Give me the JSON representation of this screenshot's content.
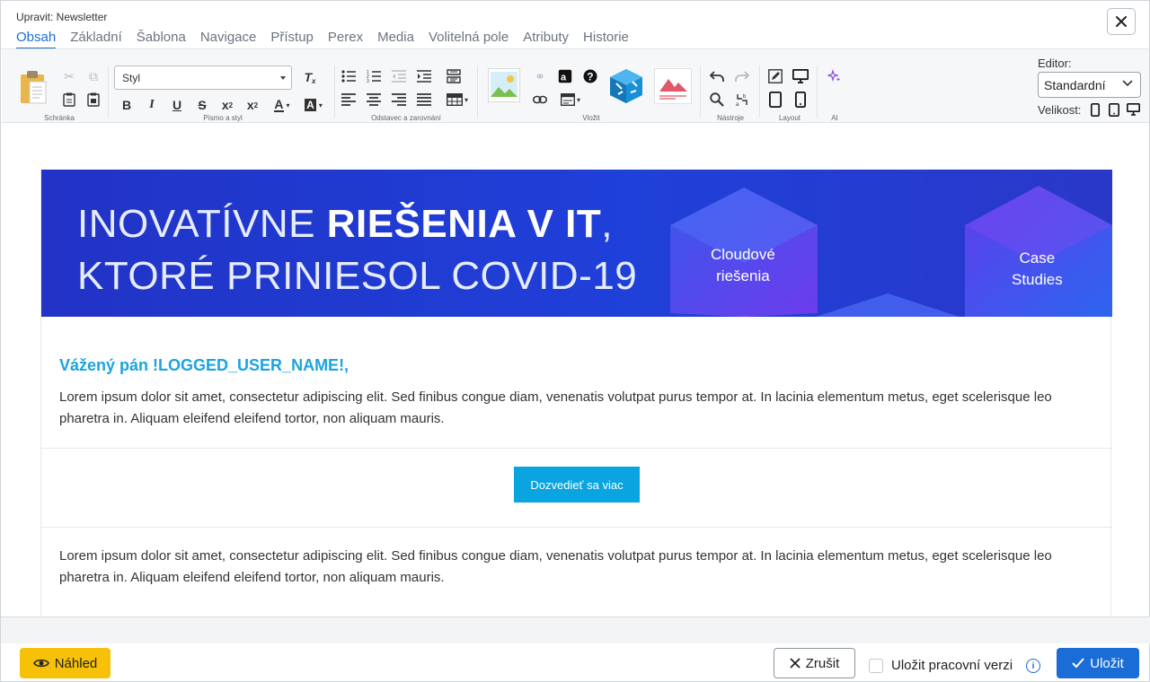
{
  "header": {
    "title": "Upravit: Newsletter",
    "tabs": [
      "Obsah",
      "Základní",
      "Šablona",
      "Navigace",
      "Přístup",
      "Perex",
      "Media",
      "Volitelná pole",
      "Atributy",
      "Historie"
    ],
    "active_tab": "Obsah"
  },
  "toolbar": {
    "style_select": "Styl",
    "groups": {
      "clipboard": "Schránka",
      "font": "Písmo a styl",
      "paragraph": "Odstavec a zarovnání",
      "insert": "Vložit",
      "tools": "Nástroje",
      "layout": "Layout",
      "ai": "AI"
    },
    "editor_label": "Editor:",
    "editor_value": "Standardní",
    "size_label": "Velikost:"
  },
  "newsletter": {
    "banner": {
      "line1_light": "INOVATÍVNE ",
      "line1_bold": "RIEŠENIA V IT",
      "line1_comma": ",",
      "line2": "KTORÉ PRINIESOL COVID-19",
      "cube1_line1": "Cloudové",
      "cube1_line2": "riešenia",
      "cube2_line1": "Case",
      "cube2_line2": "Studies"
    },
    "greeting": "Vážený pán !LOGGED_USER_NAME!,",
    "paragraph1": "Lorem ipsum dolor sit amet, consectetur adipiscing elit. Sed finibus congue diam, venenatis volutpat purus tempor at. In lacinia elementum metus, eget scelerisque leo pharetra in. Aliquam eleifend eleifend tortor, non aliquam mauris.",
    "cta_label": "Dozvedieť sa viac",
    "paragraph2": "Lorem ipsum dolor sit amet, consectetur adipiscing elit. Sed finibus congue diam, venenatis volutpat purus tempor at. In lacinia elementum metus, eget scelerisque leo pharetra in. Aliquam eleifend eleifend tortor, non aliquam mauris."
  },
  "footer": {
    "preview_label": "Náhled",
    "cancel_label": "Zrušit",
    "draft_label": "Uložit pracovní verzi",
    "save_label": "Uložit"
  },
  "colors": {
    "accent": "#1a6dd6",
    "preview_button": "#f7c10a",
    "cta": "#0aa5e0",
    "greeting": "#1aa4e0",
    "banner": "#1f40d9"
  }
}
